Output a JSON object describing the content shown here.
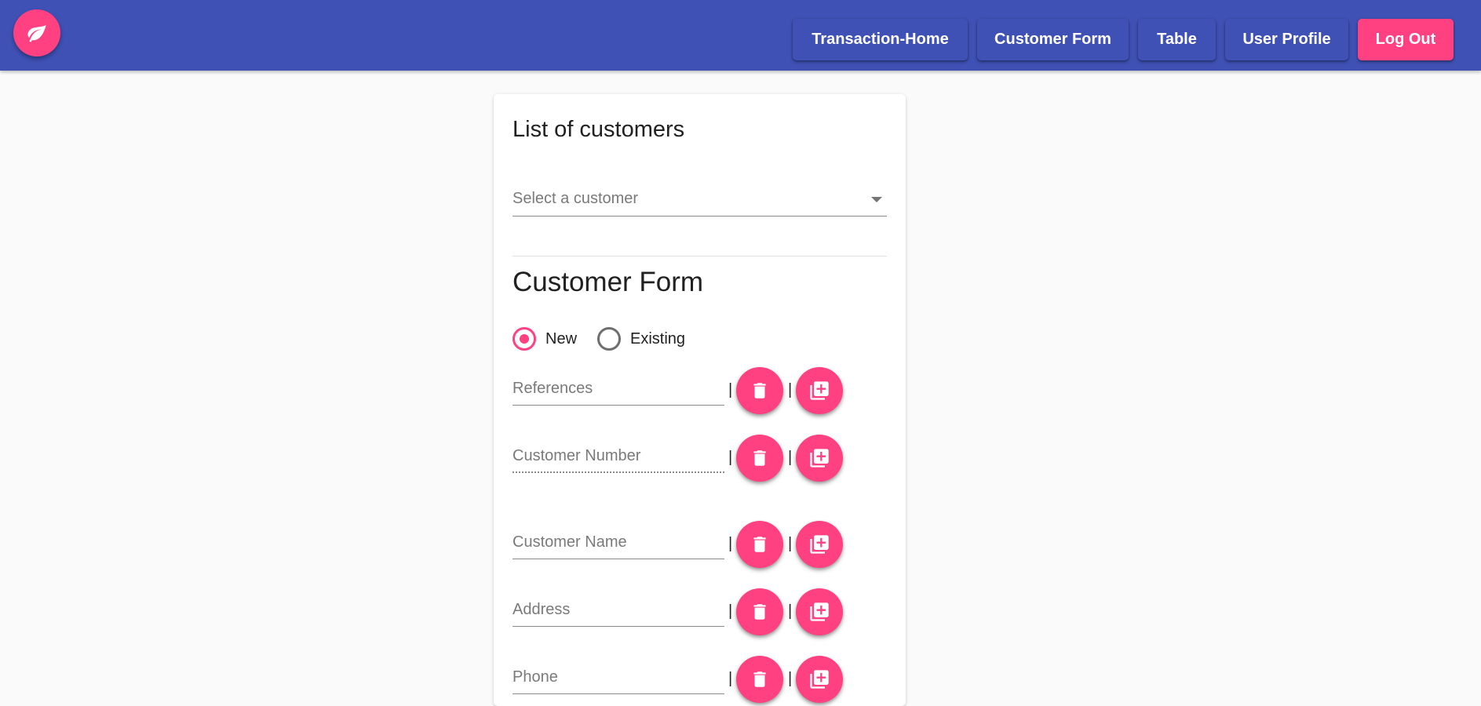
{
  "header": {
    "logo_icon": "leaf-icon",
    "nav": [
      {
        "label": "Transaction-Home"
      },
      {
        "label": "Customer Form"
      },
      {
        "label": "Table"
      },
      {
        "label": "User Profile"
      },
      {
        "label": "Log Out"
      }
    ]
  },
  "customers": {
    "title": "List of customers",
    "select_placeholder": "Select a customer"
  },
  "form": {
    "title": "Customer Form",
    "radios": [
      {
        "label": "New",
        "checked": true
      },
      {
        "label": "Existing",
        "checked": false
      }
    ],
    "separator": "|",
    "fields": [
      {
        "placeholder": "References"
      },
      {
        "placeholder": "Customer Number"
      },
      {
        "placeholder": "Customer Name"
      },
      {
        "placeholder": "Address"
      },
      {
        "placeholder": "Phone"
      }
    ],
    "delete_icon": "trash-icon",
    "add_icon": "add-copy-icon"
  },
  "colors": {
    "primary": "#3f51b5",
    "accent": "#ff4081",
    "background": "#fafafa"
  }
}
